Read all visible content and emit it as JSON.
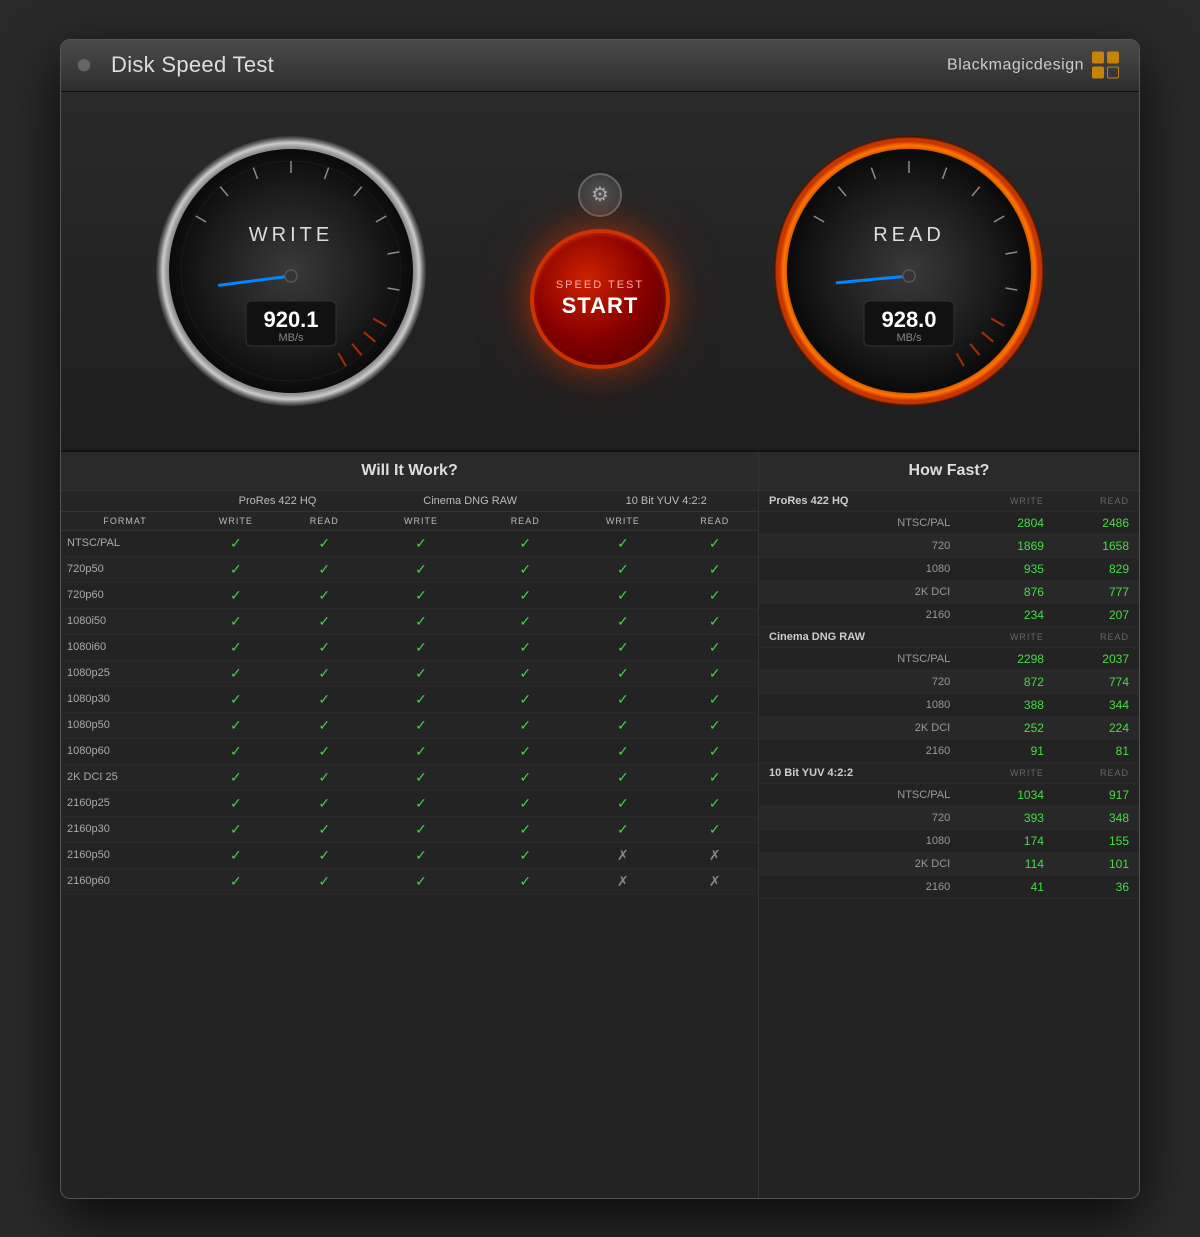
{
  "window": {
    "title": "Disk Speed Test",
    "brand": "Blackmagicdesign"
  },
  "gauges": {
    "write": {
      "label": "WRITE",
      "value": "920.1",
      "unit": "MB/s"
    },
    "read": {
      "label": "READ",
      "value": "928.0",
      "unit": "MB/s"
    },
    "start_button": {
      "line1": "SPEED TEST",
      "line2": "START"
    }
  },
  "will_it_work": {
    "header": "Will It Work?",
    "columns": {
      "format": "FORMAT",
      "prores": "ProRes 422 HQ",
      "cinema": "Cinema DNG RAW",
      "yuv": "10 Bit YUV 4:2:2",
      "write": "WRITE",
      "read": "READ"
    },
    "rows": [
      {
        "format": "NTSC/PAL",
        "p1w": true,
        "p1r": true,
        "p2w": true,
        "p2r": true,
        "p3w": true,
        "p3r": true
      },
      {
        "format": "720p50",
        "p1w": true,
        "p1r": true,
        "p2w": true,
        "p2r": true,
        "p3w": true,
        "p3r": true
      },
      {
        "format": "720p60",
        "p1w": true,
        "p1r": true,
        "p2w": true,
        "p2r": true,
        "p3w": true,
        "p3r": true
      },
      {
        "format": "1080i50",
        "p1w": true,
        "p1r": true,
        "p2w": true,
        "p2r": true,
        "p3w": true,
        "p3r": true
      },
      {
        "format": "1080i60",
        "p1w": true,
        "p1r": true,
        "p2w": true,
        "p2r": true,
        "p3w": true,
        "p3r": true
      },
      {
        "format": "1080p25",
        "p1w": true,
        "p1r": true,
        "p2w": true,
        "p2r": true,
        "p3w": true,
        "p3r": true
      },
      {
        "format": "1080p30",
        "p1w": true,
        "p1r": true,
        "p2w": true,
        "p2r": true,
        "p3w": true,
        "p3r": true
      },
      {
        "format": "1080p50",
        "p1w": true,
        "p1r": true,
        "p2w": true,
        "p2r": true,
        "p3w": true,
        "p3r": true
      },
      {
        "format": "1080p60",
        "p1w": true,
        "p1r": true,
        "p2w": true,
        "p2r": true,
        "p3w": true,
        "p3r": true
      },
      {
        "format": "2K DCI 25",
        "p1w": true,
        "p1r": true,
        "p2w": true,
        "p2r": true,
        "p3w": true,
        "p3r": true
      },
      {
        "format": "2160p25",
        "p1w": true,
        "p1r": true,
        "p2w": true,
        "p2r": true,
        "p3w": true,
        "p3r": true
      },
      {
        "format": "2160p30",
        "p1w": true,
        "p1r": true,
        "p2w": true,
        "p2r": true,
        "p3w": true,
        "p3r": true
      },
      {
        "format": "2160p50",
        "p1w": true,
        "p1r": true,
        "p2w": true,
        "p2r": true,
        "p3w": false,
        "p3r": false
      },
      {
        "format": "2160p60",
        "p1w": true,
        "p1r": true,
        "p2w": true,
        "p2r": true,
        "p3w": false,
        "p3r": false
      }
    ]
  },
  "how_fast": {
    "header": "How Fast?",
    "sections": [
      {
        "name": "ProRes 422 HQ",
        "rows": [
          {
            "label": "NTSC/PAL",
            "write": "2804",
            "read": "2486"
          },
          {
            "label": "720",
            "write": "1869",
            "read": "1658"
          },
          {
            "label": "1080",
            "write": "935",
            "read": "829"
          },
          {
            "label": "2K DCI",
            "write": "876",
            "read": "777"
          },
          {
            "label": "2160",
            "write": "234",
            "read": "207"
          }
        ]
      },
      {
        "name": "Cinema DNG RAW",
        "rows": [
          {
            "label": "NTSC/PAL",
            "write": "2298",
            "read": "2037"
          },
          {
            "label": "720",
            "write": "872",
            "read": "774"
          },
          {
            "label": "1080",
            "write": "388",
            "read": "344"
          },
          {
            "label": "2K DCI",
            "write": "252",
            "read": "224"
          },
          {
            "label": "2160",
            "write": "91",
            "read": "81"
          }
        ]
      },
      {
        "name": "10 Bit YUV 4:2:2",
        "rows": [
          {
            "label": "NTSC/PAL",
            "write": "1034",
            "read": "917"
          },
          {
            "label": "720",
            "write": "393",
            "read": "348"
          },
          {
            "label": "1080",
            "write": "174",
            "read": "155"
          },
          {
            "label": "2K DCI",
            "write": "114",
            "read": "101"
          },
          {
            "label": "2160",
            "write": "41",
            "read": "36"
          }
        ]
      }
    ]
  }
}
